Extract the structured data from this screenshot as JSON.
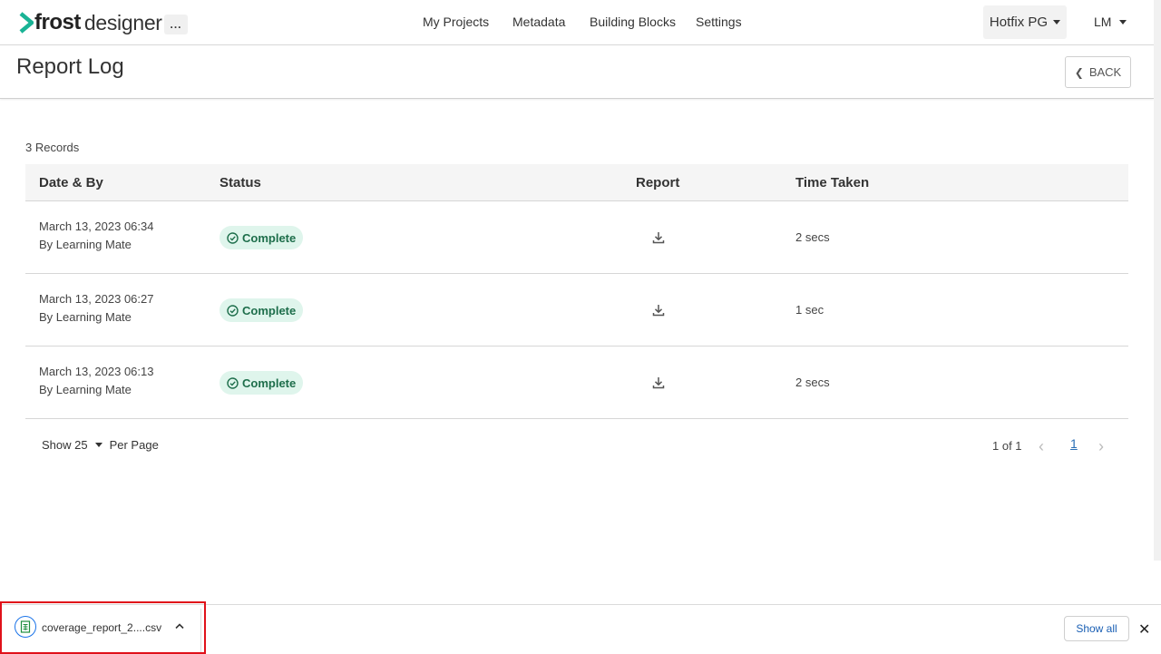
{
  "app": {
    "logo_bold": "frost",
    "logo_light": "designer",
    "more": "..."
  },
  "nav": {
    "items": [
      "My Projects",
      "Metadata",
      "Building Blocks",
      "Settings"
    ]
  },
  "org": {
    "name": "Hotfix PG"
  },
  "user": {
    "initials": "LM"
  },
  "page": {
    "title": "Report Log",
    "back_label": "BACK"
  },
  "records": {
    "count_label": "3 Records"
  },
  "table": {
    "headers": [
      "Date & By",
      "Status",
      "Report",
      "Time Taken"
    ],
    "rows": [
      {
        "date": "March 13, 2023 06:34",
        "by": "By Learning Mate",
        "status": "Complete",
        "time": "2 secs"
      },
      {
        "date": "March 13, 2023 06:27",
        "by": "By Learning Mate",
        "status": "Complete",
        "time": "1 sec"
      },
      {
        "date": "March 13, 2023 06:13",
        "by": "By Learning Mate",
        "status": "Complete",
        "time": "2 secs"
      }
    ]
  },
  "pagination": {
    "show_label": "Show 25",
    "per_page_label": "Per Page",
    "page_info": "1 of 1",
    "current_page": "1"
  },
  "downloads": {
    "file_name": "coverage_report_2....csv",
    "show_all": "Show all"
  },
  "colors": {
    "status_bg": "#dff5ec",
    "status_text": "#1e6e4b",
    "link": "#2a6fb6",
    "highlight": "#e0111a"
  }
}
